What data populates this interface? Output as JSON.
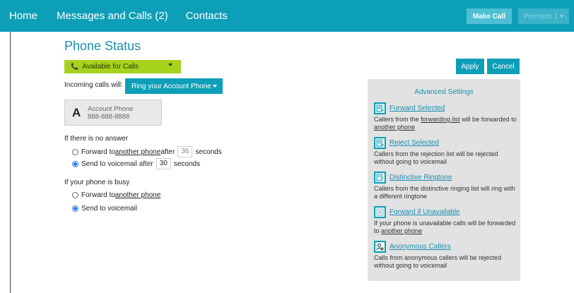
{
  "nav": {
    "home": "Home",
    "messages": "Messages and Calls (2)",
    "contacts": "Contacts",
    "make_call": "Make Call",
    "premium": "Premium 1",
    "premium_caret": "▾"
  },
  "page": {
    "title": "Phone Status"
  },
  "status": {
    "availability": "Available for Calls"
  },
  "incoming": {
    "label": "Incoming calls will:",
    "mode": "Ring your Account Phone"
  },
  "account": {
    "letter": "A",
    "name": "Account Phone",
    "number": "888-888-8888"
  },
  "no_answer": {
    "label": "If there is no answer",
    "forward_prefix": "Forward to ",
    "forward_link": "another phone",
    "forward_after": " after",
    "forward_seconds": "36",
    "seconds_word": "seconds",
    "voicemail_prefix": "Send to voicemail after",
    "voicemail_seconds": "30",
    "selected": "voicemail"
  },
  "busy": {
    "label": "If your phone is busy",
    "forward_prefix": "Forward to ",
    "forward_link": "another phone",
    "voicemail": "Send to voicemail",
    "selected": "voicemail"
  },
  "actions": {
    "apply": "Apply",
    "cancel": "Cancel"
  },
  "advanced": {
    "title": "Advanced Settings",
    "forward_selected": {
      "icon": "forward-list-icon",
      "title": "Forward Selected",
      "d1": "Callers from the ",
      "d1_link": "forwarding list",
      "d2": " will be forwarded to ",
      "d2_link": "another phone"
    },
    "reject_selected": {
      "icon": "reject-list-icon",
      "title": "Reject Selected",
      "desc": "Callers from the rejection list will be rejected without going to voicemail"
    },
    "distinctive": {
      "icon": "distinctive-ringtone-icon",
      "title": "Distinctive Ringtone",
      "desc": "Callers from the distinctive ringing list will ring with a different ringtone"
    },
    "forward_unavailable": {
      "icon": "forward-unavailable-icon",
      "title": "Forward if Unavailable",
      "d1": "If your phone is unavailable calls will be forwarded to ",
      "d1_link": "another phone"
    },
    "anonymous": {
      "icon": "anonymous-callers-icon",
      "title": "Anonymous Callers",
      "desc": "Calls from anonymous callers will be rejected without going to voicemail"
    }
  },
  "colors": {
    "brand": "#0d9fb8",
    "available": "#a6d21d",
    "panel": "#e2e2e2"
  }
}
